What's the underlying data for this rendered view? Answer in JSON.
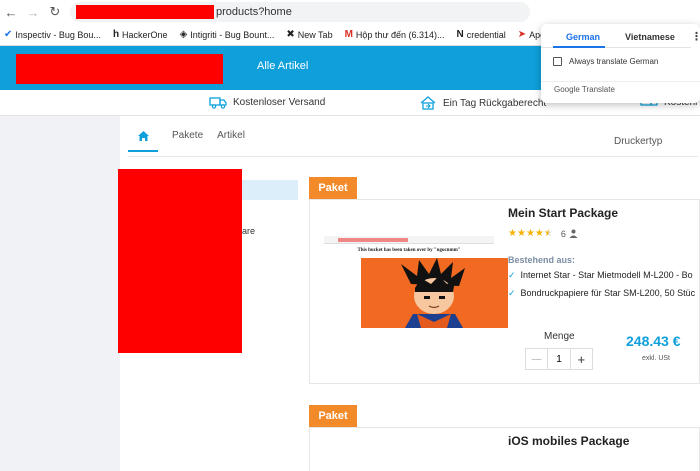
{
  "browser": {
    "url_suffix": "products?home",
    "bookmarks": [
      {
        "label": "Inspectiv - Bug Bou...",
        "icon": "check-icon",
        "color": "#1a73e8"
      },
      {
        "label": "HackerOne",
        "icon": "h-icon",
        "color": "#222222"
      },
      {
        "label": "Intigriti - Bug Bount...",
        "icon": "intigriti-icon",
        "color": "#222222"
      },
      {
        "label": "New Tab",
        "icon": "x-icon",
        "color": "#222222"
      },
      {
        "label": "Hộp thư đến (6.314)...",
        "icon": "gmail-icon",
        "color": "#d93025"
      },
      {
        "label": "credential",
        "icon": "notion-icon",
        "color": "#222222"
      },
      {
        "label": "Aperi'So",
        "icon": "aperi-icon",
        "color": "#d93025"
      }
    ]
  },
  "header": {
    "all_articles": "Alle Artikel"
  },
  "benefits": {
    "shipping": "Kostenloser Versand",
    "return": "Ein Tag Rückgaberecht",
    "third_partial": "Kostenl"
  },
  "tabs": {
    "packages": "Pakete",
    "articles": "Artikel",
    "printer_type": "Druckertyp"
  },
  "sidebar": {
    "partial_text": "are"
  },
  "products": [
    {
      "badge": "Paket",
      "title": "Mein Start Package",
      "rating": 4.5,
      "review_count": "6",
      "includes_label": "Bestehend aus:",
      "items": [
        "Internet Star - Star Mietmodell M-L200 - Bo",
        "Bondruckpapiere für Star SM-L200, 50 Stüc"
      ],
      "quantity_label": "Menge",
      "quantity": "1",
      "price": "248.43 €",
      "vat": "exkl. USt",
      "image_caption": "This bucket has been taken over by \"ngocnmm\""
    },
    {
      "badge": "Paket",
      "title": "iOS mobiles Package"
    }
  ],
  "translate_popup": {
    "lang_from": "German",
    "lang_to": "Vietnamese",
    "always_translate": "Always translate German",
    "brand": "Google Translate"
  },
  "colors": {
    "brand_blue": "#0fa0dc",
    "badge_orange": "#f28a2a",
    "star_yellow": "#f5b301",
    "redaction": "#ff0000"
  }
}
